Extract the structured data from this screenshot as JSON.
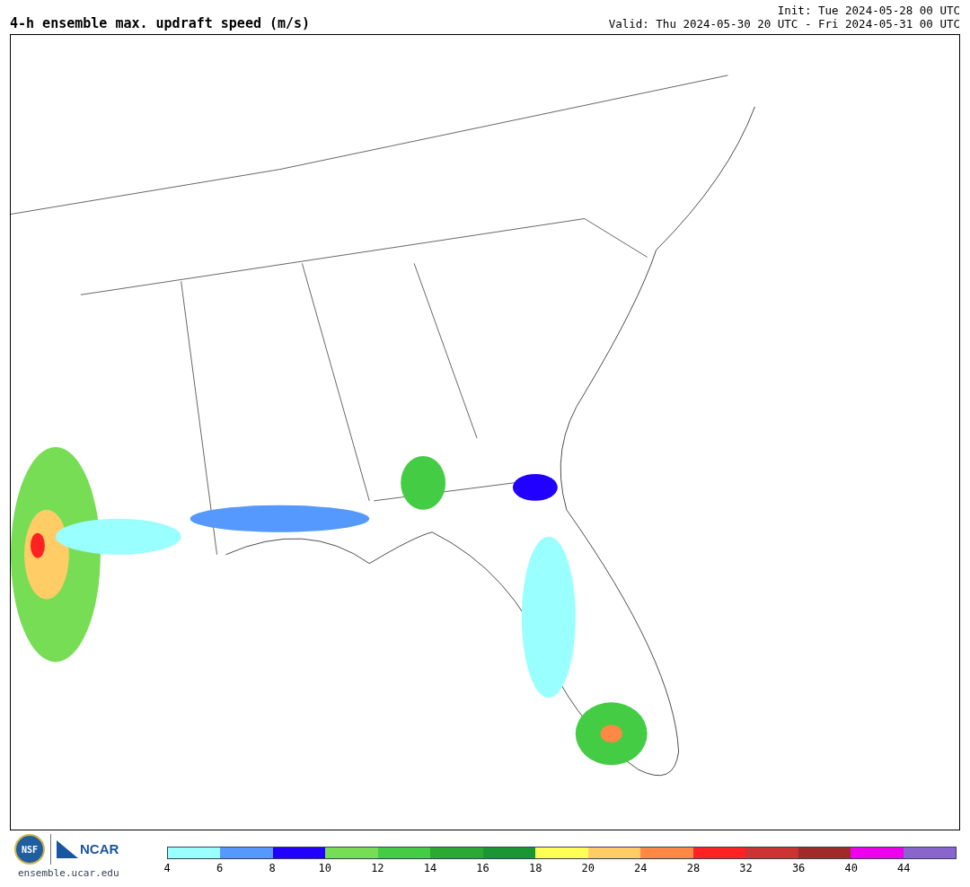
{
  "title": "4-h ensemble max. updraft speed (m/s)",
  "init": "Init: Tue 2024-05-28 00 UTC",
  "valid": "Valid: Thu 2024-05-30 20 UTC - Fri 2024-05-31 00 UTC",
  "footer": {
    "logo_left": "NSF",
    "logo_right": "NCAR",
    "site": "ensemble.ucar.edu"
  },
  "colorbar": {
    "segments": [
      {
        "color": "#99ffff"
      },
      {
        "color": "#5599ff"
      },
      {
        "color": "#2200ff"
      },
      {
        "color": "#77dd55"
      },
      {
        "color": "#44cc44"
      },
      {
        "color": "#2aaa33"
      },
      {
        "color": "#1a9633"
      },
      {
        "color": "#ffff55"
      },
      {
        "color": "#ffcc66"
      },
      {
        "color": "#ff8844"
      },
      {
        "color": "#ff2222"
      },
      {
        "color": "#cc3333"
      },
      {
        "color": "#a02a2a"
      },
      {
        "color": "#ee00ee"
      },
      {
        "color": "#8866cc"
      }
    ],
    "ticks": [
      "4",
      "6",
      "8",
      "10",
      "12",
      "14",
      "16",
      "18",
      "20",
      "24",
      "28",
      "32",
      "36",
      "40",
      "44"
    ]
  }
}
